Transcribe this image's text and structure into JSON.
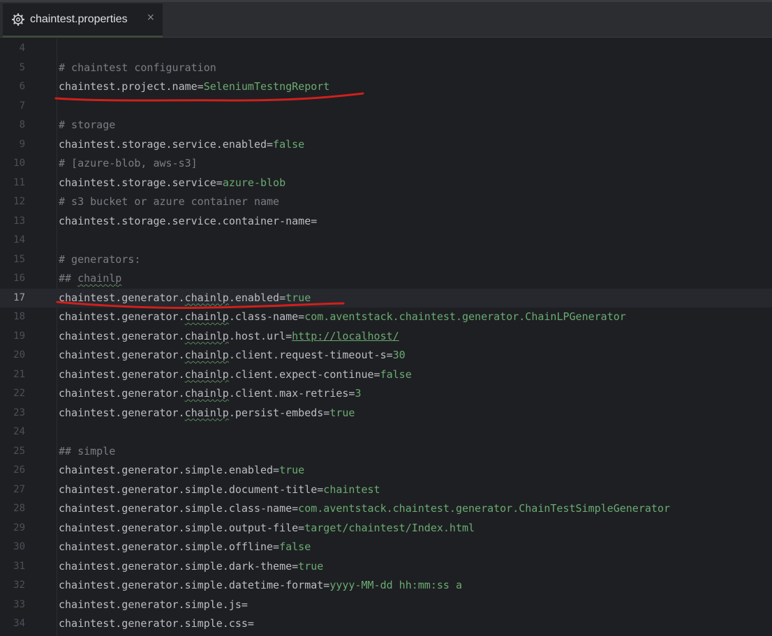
{
  "tab": {
    "label": "chaintest.properties",
    "close_glyph": "×",
    "icon": "gear-icon"
  },
  "editor": {
    "current_line": 17,
    "lines": [
      {
        "n": "4",
        "key": "",
        "val": "",
        "type": "blank"
      },
      {
        "n": "5",
        "text": "# chaintest configuration",
        "type": "comment"
      },
      {
        "n": "6",
        "key": "chaintest.project.name=",
        "val": "SeleniumTestngReport",
        "type": "kv"
      },
      {
        "n": "7",
        "type": "blank"
      },
      {
        "n": "8",
        "text": "# storage",
        "type": "comment"
      },
      {
        "n": "9",
        "key": "chaintest.storage.service.enabled=",
        "val": "false",
        "type": "kv"
      },
      {
        "n": "10",
        "text": "# [azure-blob, aws-s3]",
        "type": "comment"
      },
      {
        "n": "11",
        "key": "chaintest.storage.service=",
        "val": "azure-blob",
        "type": "kv"
      },
      {
        "n": "12",
        "text": "# s3 bucket or azure container name",
        "type": "comment"
      },
      {
        "n": "13",
        "key": "chaintest.storage.service.container-name=",
        "val": "",
        "type": "kv"
      },
      {
        "n": "14",
        "type": "blank"
      },
      {
        "n": "15",
        "text": "# generators:",
        "type": "comment"
      },
      {
        "n": "16",
        "text": "## chainlp",
        "type": "comment"
      },
      {
        "n": "17",
        "key": "chaintest.generator.chainlp.enabled=",
        "val": "true",
        "type": "kv"
      },
      {
        "n": "18",
        "key": "chaintest.generator.chainlp.class-name=",
        "val": "com.aventstack.chaintest.generator.ChainLPGenerator",
        "type": "kv"
      },
      {
        "n": "19",
        "key": "chaintest.generator.chainlp.host.url=",
        "val": "http://localhost/",
        "type": "kv"
      },
      {
        "n": "20",
        "key": "chaintest.generator.chainlp.client.request-timeout-s=",
        "val": "30",
        "type": "kv"
      },
      {
        "n": "21",
        "key": "chaintest.generator.chainlp.client.expect-continue=",
        "val": "false",
        "type": "kv"
      },
      {
        "n": "22",
        "key": "chaintest.generator.chainlp.client.max-retries=",
        "val": "3",
        "type": "kv"
      },
      {
        "n": "23",
        "key": "chaintest.generator.chainlp.persist-embeds=",
        "val": "true",
        "type": "kv"
      },
      {
        "n": "24",
        "type": "blank"
      },
      {
        "n": "25",
        "text": "## simple",
        "type": "comment"
      },
      {
        "n": "26",
        "key": "chaintest.generator.simple.enabled=",
        "val": "true",
        "type": "kv"
      },
      {
        "n": "27",
        "key": "chaintest.generator.simple.document-title=",
        "val": "chaintest",
        "type": "kv"
      },
      {
        "n": "28",
        "key": "chaintest.generator.simple.class-name=",
        "val": "com.aventstack.chaintest.generator.ChainTestSimpleGenerator",
        "type": "kv"
      },
      {
        "n": "29",
        "key": "chaintest.generator.simple.output-file=",
        "val": "target/chaintest/Index.html",
        "type": "kv"
      },
      {
        "n": "30",
        "key": "chaintest.generator.simple.offline=",
        "val": "false",
        "type": "kv"
      },
      {
        "n": "31",
        "key": "chaintest.generator.simple.dark-theme=",
        "val": "true",
        "type": "kv"
      },
      {
        "n": "32",
        "key": "chaintest.generator.simple.datetime-format=",
        "val": "yyyy-MM-dd hh:mm:ss a",
        "type": "kv"
      },
      {
        "n": "33",
        "key": "chaintest.generator.simple.js=",
        "val": "",
        "type": "kv"
      },
      {
        "n": "34",
        "key": "chaintest.generator.simple.css=",
        "val": "",
        "type": "kv"
      }
    ]
  },
  "colors": {
    "background": "#1e1f22",
    "key": "#bcbec4",
    "value": "#6aab73",
    "comment": "#7a7e85",
    "annotation": "#d0201c"
  }
}
